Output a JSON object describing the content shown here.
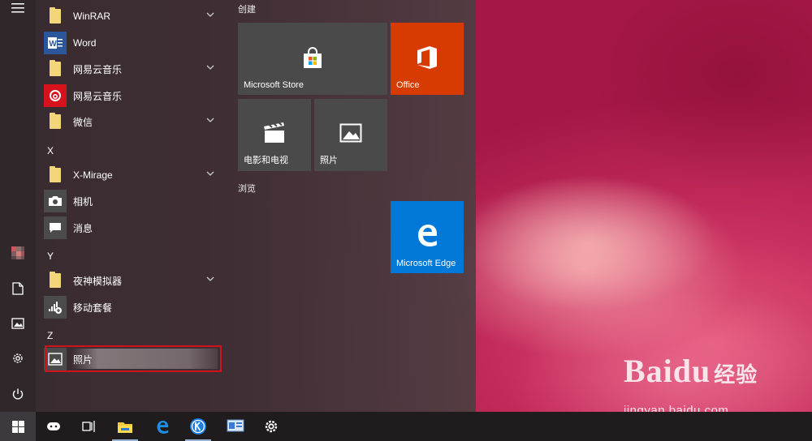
{
  "app_list": {
    "sections": [
      {
        "letter": "X"
      },
      {
        "letter": "Y"
      },
      {
        "letter": "Z"
      }
    ],
    "items": [
      {
        "label": "WinRAR",
        "type": "folder"
      },
      {
        "label": "Word",
        "type": "app"
      },
      {
        "label": "网易云音乐",
        "type": "folder"
      },
      {
        "label": "网易云音乐",
        "type": "app"
      },
      {
        "label": "微信",
        "type": "folder"
      },
      {
        "label": "X-Mirage",
        "type": "folder"
      },
      {
        "label": "相机",
        "type": "app"
      },
      {
        "label": "消息",
        "type": "app"
      },
      {
        "label": "夜神模拟器",
        "type": "folder"
      },
      {
        "label": "移动套餐",
        "type": "app"
      },
      {
        "label": "照片",
        "type": "app",
        "highlighted": true
      }
    ]
  },
  "tiles": {
    "group_create": "创建",
    "group_browse": "浏览",
    "microsoft_store": "Microsoft Store",
    "office": "Office",
    "movies_tv": "电影和电视",
    "photos": "照片",
    "edge": "Microsoft Edge"
  },
  "colors": {
    "office_tile": "#d83b01",
    "edge_tile": "#0078d7",
    "gray_tile": "#4a4a4a",
    "highlight_border": "#d0131b"
  },
  "watermark": {
    "brand_en": "Baidu",
    "brand_cn": "经验",
    "url": "jingyan.baidu.com"
  },
  "icons": {
    "rail": [
      "hamburger-icon",
      "user-avatar",
      "document-icon",
      "pictures-icon",
      "settings-gear-icon",
      "power-icon"
    ],
    "taskbar": [
      "windows-start-icon",
      "cortana-icon",
      "task-view-icon",
      "file-explorer-icon",
      "edge-icon",
      "kugou-icon",
      "control-panel-icon",
      "settings-gear-icon"
    ]
  }
}
